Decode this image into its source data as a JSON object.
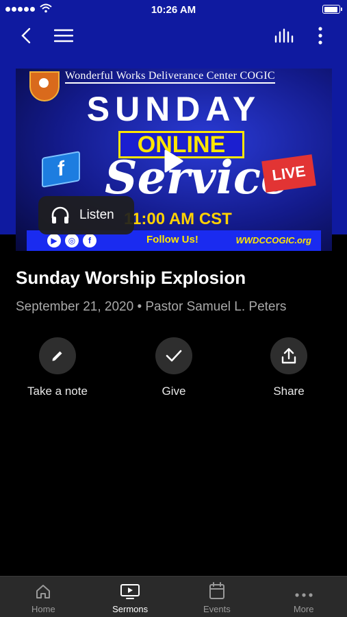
{
  "status_bar": {
    "time": "10:26 AM",
    "battery_level": 0.95
  },
  "header": {
    "back_icon": "chevron-left-icon",
    "menu_icon": "hamburger-icon",
    "audio_icon": "equalizer-icon",
    "more_icon": "vertical-dots-icon"
  },
  "thumbnail": {
    "church_name": "Wonderful Works Deliverance Center COGIC",
    "line_sunday": "SUNDAY",
    "line_online": "ONLINE",
    "line_service": "Service",
    "badge_live": "LIVE",
    "time_text": "11:00 AM CST",
    "follow_text": "Follow Us!",
    "website": "WWDCCOGIC.org",
    "fb_letter": "f",
    "yt_letter": "▶",
    "ig_letter": "◎"
  },
  "player": {
    "listen_label": "Listen"
  },
  "sermon": {
    "title": "Sunday Worship Explosion",
    "meta": "September 21, 2020 • Pastor Samuel L. Peters"
  },
  "actions": [
    {
      "label": "Take a note",
      "icon": "pencil-icon"
    },
    {
      "label": "Give",
      "icon": "check-icon"
    },
    {
      "label": "Share",
      "icon": "share-icon"
    }
  ],
  "tabs": [
    {
      "label": "Home",
      "icon": "home-icon",
      "active": false
    },
    {
      "label": "Sermons",
      "icon": "tv-play-icon",
      "active": true
    },
    {
      "label": "Events",
      "icon": "calendar-icon",
      "active": false
    },
    {
      "label": "More",
      "icon": "horizontal-dots-icon",
      "active": false
    }
  ]
}
